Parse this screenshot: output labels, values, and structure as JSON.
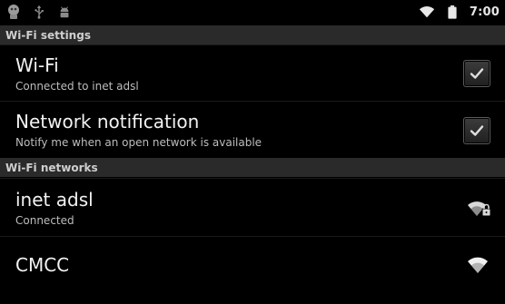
{
  "status_bar": {
    "time": "7:00",
    "left_icons": [
      "android-avatar-icon",
      "usb-icon",
      "android-debug-icon"
    ],
    "right_icons": [
      "wifi-signal-icon",
      "battery-icon"
    ]
  },
  "sections": {
    "wifi_settings": "Wi-Fi settings",
    "wifi_networks": "Wi-Fi networks"
  },
  "settings": {
    "wifi": {
      "title": "Wi-Fi",
      "summary": "Connected to inet adsl",
      "checked": true
    },
    "network_notification": {
      "title": "Network notification",
      "summary": "Notify me when an open network is available",
      "checked": true
    }
  },
  "networks": [
    {
      "name": "inet adsl",
      "status": "Connected",
      "secured": true
    },
    {
      "name": "CMCC",
      "status": "",
      "secured": false
    }
  ]
}
